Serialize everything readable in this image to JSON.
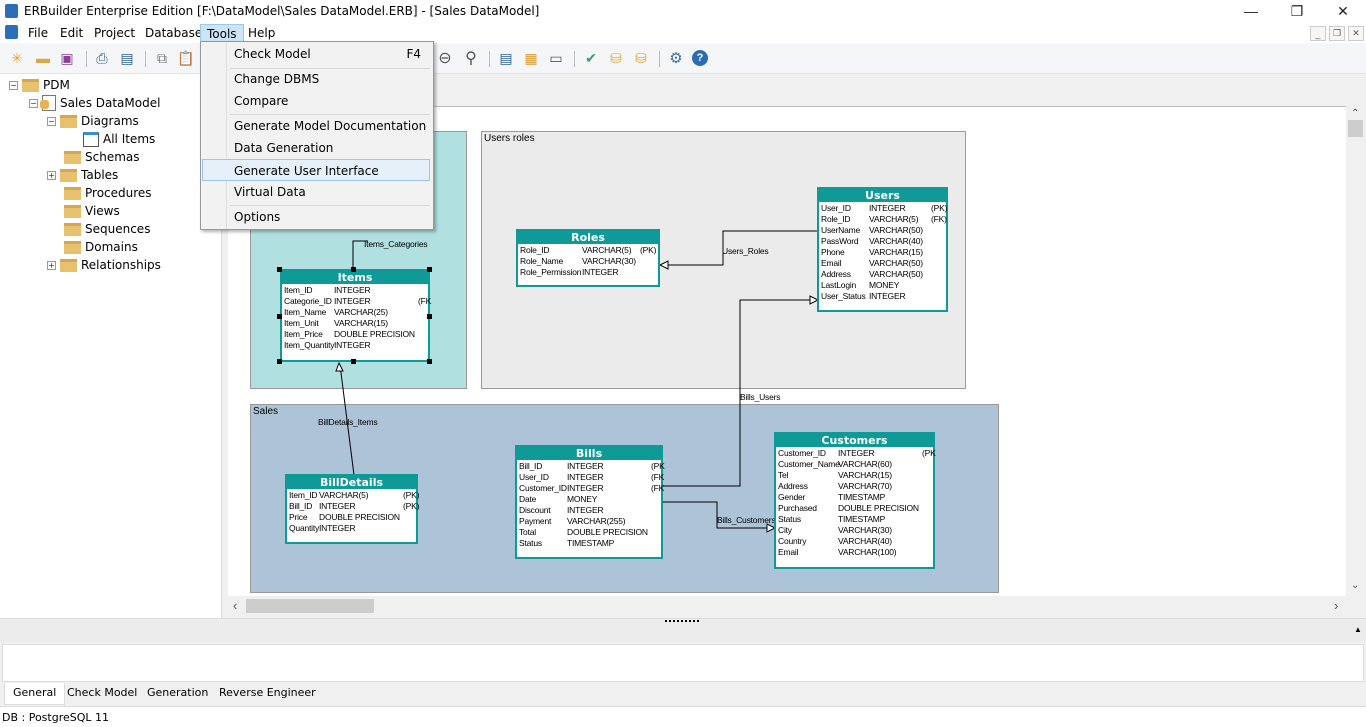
{
  "window": {
    "title": "ERBuilder Enterprise Edition [F:\\DataModel\\Sales DataModel.ERB] - [Sales DataModel]",
    "minimize": "—",
    "maximize": "❐",
    "close": "✕"
  },
  "menubar": {
    "items": [
      {
        "label": "File"
      },
      {
        "label": "Edit"
      },
      {
        "label": "Project"
      },
      {
        "label": "Database"
      },
      {
        "label": "Tools"
      },
      {
        "label": "Help"
      }
    ],
    "open_menu": "Tools"
  },
  "mdi_controls": {
    "minimize": "_",
    "restore": "❐",
    "close": "✕"
  },
  "toolbar": {
    "buttons": [
      {
        "icon": "new-icon",
        "glyph": "✳"
      },
      {
        "icon": "open-folder-icon",
        "glyph": "▬"
      },
      {
        "icon": "save-icon",
        "glyph": "▣"
      },
      {
        "icon": "print-icon",
        "glyph": "⎙"
      },
      {
        "icon": "print-preview-icon",
        "glyph": "▤"
      },
      {
        "icon": "copy-icon",
        "glyph": "⧉"
      },
      {
        "icon": "paste-icon",
        "glyph": "📋"
      },
      {
        "icon": "zoom-out-icon",
        "glyph": "⊖"
      },
      {
        "icon": "zoom-icon",
        "glyph": "⚲"
      },
      {
        "icon": "document-icon",
        "glyph": "▤"
      },
      {
        "icon": "report-icon",
        "glyph": "▦"
      },
      {
        "icon": "layout-icon",
        "glyph": "▭"
      },
      {
        "icon": "check-model-icon",
        "glyph": "✔"
      },
      {
        "icon": "database-sync-icon",
        "glyph": "⛁"
      },
      {
        "icon": "database-save-icon",
        "glyph": "⛁"
      },
      {
        "icon": "settings-icon",
        "glyph": "⚙"
      },
      {
        "icon": "help-icon",
        "glyph": "?"
      }
    ]
  },
  "tools_menu": {
    "items": [
      {
        "label": "Check Model",
        "shortcut": "F4"
      },
      {
        "label": "Change DBMS",
        "shortcut": ""
      },
      {
        "label": "Compare",
        "shortcut": ""
      },
      {
        "label": "Generate Model Documentation",
        "shortcut": ""
      },
      {
        "label": "Data Generation",
        "shortcut": ""
      },
      {
        "label": "Generate User Interface",
        "shortcut": "",
        "highlighted": true
      },
      {
        "label": "Virtual Data",
        "shortcut": ""
      },
      {
        "label": "Options",
        "shortcut": ""
      }
    ]
  },
  "tree": {
    "items": [
      {
        "label": "PDM",
        "expander": "−"
      },
      {
        "label": "Sales DataModel",
        "expander": "−"
      },
      {
        "label": "Diagrams",
        "expander": "−"
      },
      {
        "label": "All Items"
      },
      {
        "label": "Schemas"
      },
      {
        "label": "Tables",
        "expander": "+"
      },
      {
        "label": "Procedures"
      },
      {
        "label": "Views"
      },
      {
        "label": "Sequences"
      },
      {
        "label": "Domains"
      },
      {
        "label": "Relationships",
        "expander": "+"
      }
    ]
  },
  "diagram": {
    "areas": [
      {
        "label": ""
      },
      {
        "label": "Users roles"
      },
      {
        "label": "Sales"
      }
    ],
    "entities": {
      "items": {
        "name": "Items",
        "columns": [
          [
            "Item_ID",
            "INTEGER",
            ""
          ],
          [
            "Categorie_ID",
            "INTEGER",
            "(FK"
          ],
          [
            "Item_Name",
            "VARCHAR(25)",
            ""
          ],
          [
            "Item_Unit",
            "VARCHAR(15)",
            ""
          ],
          [
            "Item_Price",
            "DOUBLE PRECISION",
            ""
          ],
          [
            "Item_Quantity",
            "INTEGER",
            ""
          ]
        ]
      },
      "roles": {
        "name": "Roles",
        "columns": [
          [
            "Role_ID",
            "VARCHAR(5)",
            "(PK)"
          ],
          [
            "Role_Name",
            "VARCHAR(30)",
            ""
          ],
          [
            "Role_Permission",
            "INTEGER",
            ""
          ]
        ]
      },
      "users": {
        "name": "Users",
        "columns": [
          [
            "User_ID",
            "INTEGER",
            "(PK)"
          ],
          [
            "Role_ID",
            "VARCHAR(5)",
            "(FK)"
          ],
          [
            "UserName",
            "VARCHAR(50)",
            ""
          ],
          [
            "PassWord",
            "VARCHAR(40)",
            ""
          ],
          [
            "Phone",
            "VARCHAR(15)",
            ""
          ],
          [
            "Email",
            "VARCHAR(50)",
            ""
          ],
          [
            "Address",
            "VARCHAR(50)",
            ""
          ],
          [
            "LastLogin",
            "MONEY",
            ""
          ],
          [
            "User_Status",
            "INTEGER",
            ""
          ]
        ]
      },
      "billdetails": {
        "name": "BillDetails",
        "columns": [
          [
            "Item_ID",
            "VARCHAR(5)",
            "(PK)"
          ],
          [
            "Bill_ID",
            "INTEGER",
            "(PK)"
          ],
          [
            "Price",
            "DOUBLE PRECISION",
            ""
          ],
          [
            "Quantity",
            "INTEGER",
            ""
          ]
        ]
      },
      "bills": {
        "name": "Bills",
        "columns": [
          [
            "Bill_ID",
            "INTEGER",
            "(PK"
          ],
          [
            "User_ID",
            "INTEGER",
            "(FK"
          ],
          [
            "Customer_ID",
            "INTEGER",
            "(FK"
          ],
          [
            "Date",
            "MONEY",
            ""
          ],
          [
            "Discount",
            "INTEGER",
            ""
          ],
          [
            "Payment",
            "VARCHAR(255)",
            ""
          ],
          [
            "Total",
            "DOUBLE PRECISION",
            ""
          ],
          [
            "Status",
            "TIMESTAMP",
            ""
          ]
        ]
      },
      "customers": {
        "name": "Customers",
        "columns": [
          [
            "Customer_ID",
            "INTEGER",
            "(PK"
          ],
          [
            "Customer_Name",
            "VARCHAR(60)",
            ""
          ],
          [
            "Tel",
            "VARCHAR(15)",
            ""
          ],
          [
            "Address",
            "VARCHAR(70)",
            ""
          ],
          [
            "Gender",
            "TIMESTAMP",
            ""
          ],
          [
            "Purchased",
            "DOUBLE PRECISION",
            ""
          ],
          [
            "Status",
            "TIMESTAMP",
            ""
          ],
          [
            "City",
            "VARCHAR(30)",
            ""
          ],
          [
            "Country",
            "VARCHAR(40)",
            ""
          ],
          [
            "Email",
            "VARCHAR(100)",
            ""
          ]
        ]
      }
    },
    "relationships": [
      "Items_Categories",
      "Users_Roles",
      "Bills_Users",
      "BillDetails_Items",
      "Bills_Customers"
    ]
  },
  "bottom_tabs": [
    {
      "label": "General",
      "active": true
    },
    {
      "label": "Check Model"
    },
    {
      "label": "Generation"
    },
    {
      "label": "Reverse Engineer"
    }
  ],
  "status": {
    "db": "DB : PostgreSQL 11"
  }
}
